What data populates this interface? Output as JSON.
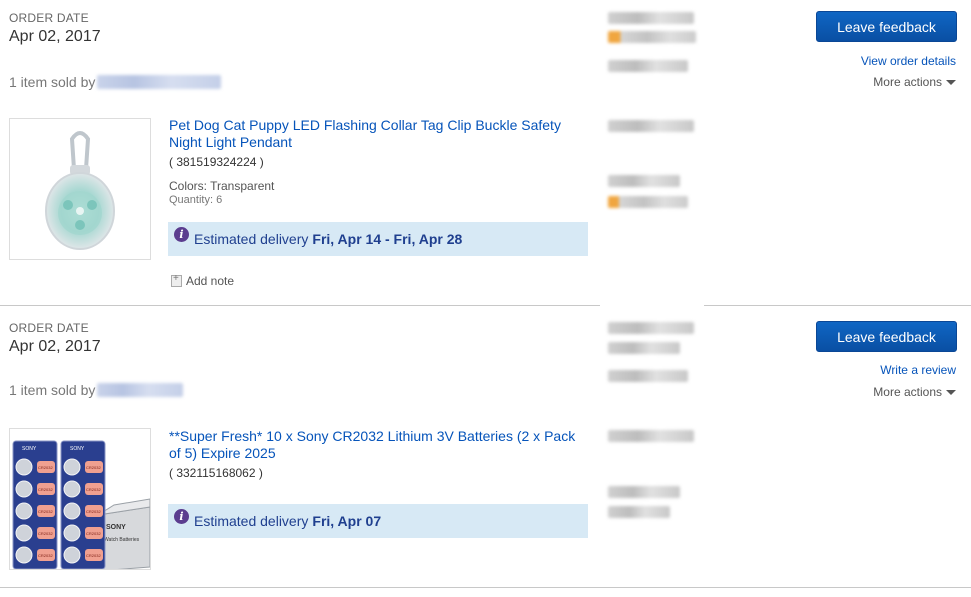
{
  "orders": [
    {
      "order_date_label": "ORDER DATE",
      "order_date": "Apr 02, 2017",
      "sold_by_prefix": "1 item sold by",
      "leave_feedback": "Leave feedback",
      "secondary_link": "View order details",
      "more_actions": "More actions",
      "item": {
        "title": "Pet Dog Cat Puppy LED Flashing Collar Tag Clip Buckle Safety Night Light Pendant",
        "item_number": "( 381519324224 )",
        "colors": "Colors: Transparent",
        "quantity": "Quantity: 6",
        "eta_label": "Estimated delivery",
        "eta_dates": "Fri, Apr 14 - Fri, Apr 28",
        "add_note": "Add note"
      }
    },
    {
      "order_date_label": "ORDER DATE",
      "order_date": "Apr 02, 2017",
      "sold_by_prefix": "1 item sold by",
      "leave_feedback": "Leave feedback",
      "secondary_link": "Write a review",
      "more_actions": "More actions",
      "item": {
        "title": "**Super Fresh* 10 x Sony CR2032 Lithium 3V Batteries (2 x Pack of 5) Expire 2025",
        "item_number": "( 332115168062 )",
        "eta_label": "Estimated delivery",
        "eta_dates": "Fri, Apr 07",
        "product_image_text": {
          "brand": "SONY",
          "cell": "CR2032",
          "box": "Watch Batteries"
        }
      }
    }
  ],
  "colors": {
    "link": "#0654ba",
    "button": "#0a4fa3",
    "eta_background": "#d7e9f5",
    "info_icon": "#5b3d8f"
  },
  "icons": {
    "eta": "info-icon",
    "note": "note-icon",
    "more_actions": "caret-down-icon"
  }
}
